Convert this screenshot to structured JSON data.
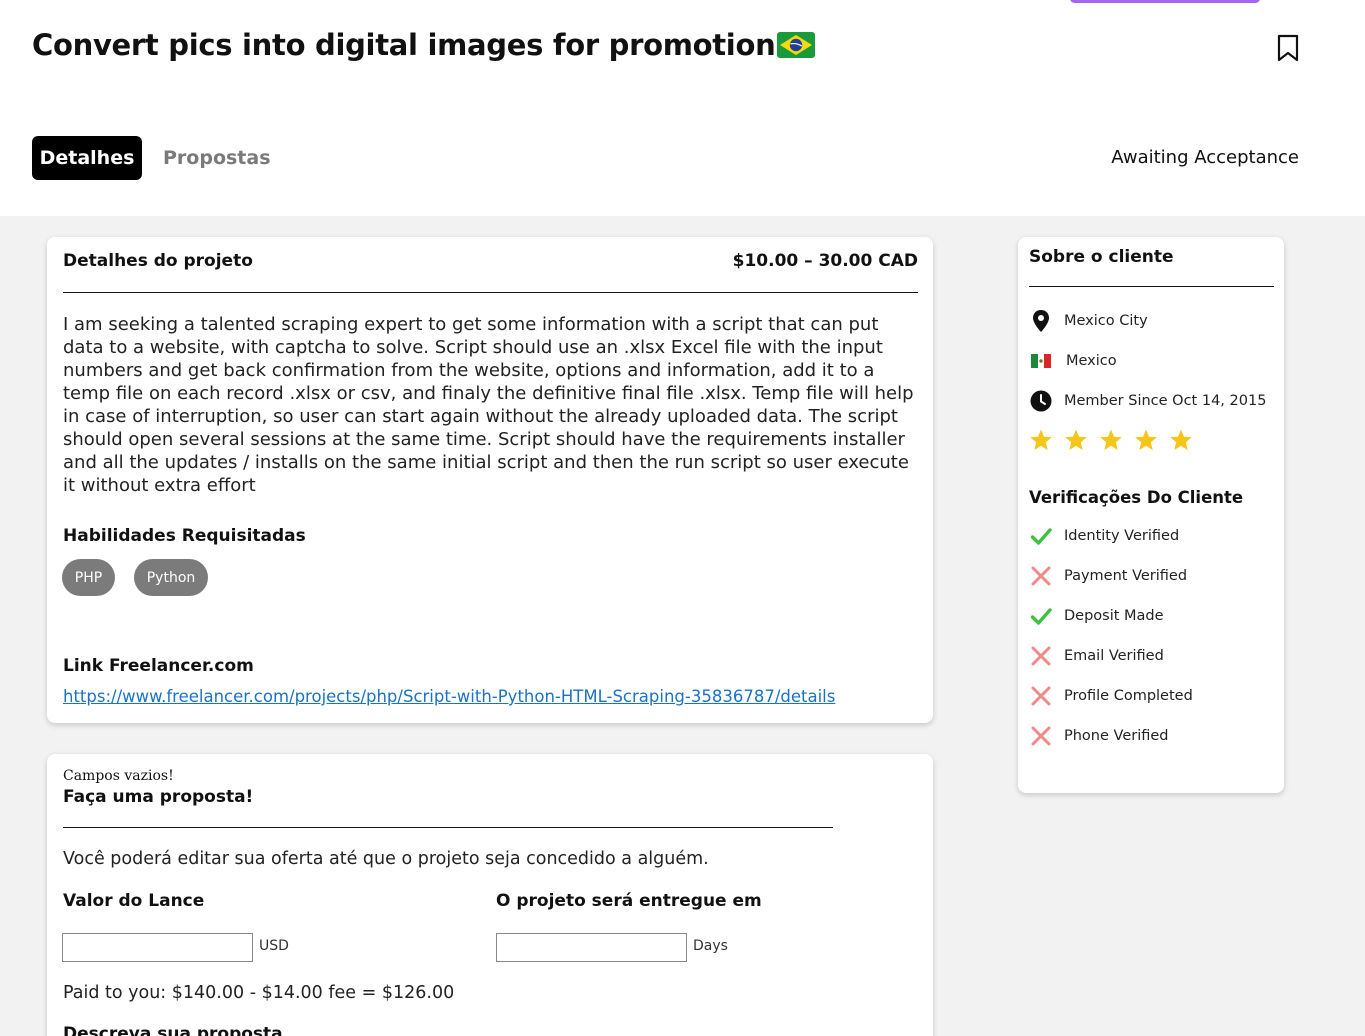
{
  "header": {
    "title": "Convert pics into digital images for promotion",
    "title_flag": "brazil-flag",
    "bookmark_icon": "bookmark-icon",
    "tabs": [
      {
        "label": "Detalhes",
        "active": true
      },
      {
        "label": "Propostas",
        "active": false
      }
    ],
    "status": "Awaiting Acceptance",
    "accent": "#a766f0"
  },
  "project": {
    "heading": "Detalhes do projeto",
    "budget": "$10.00 – 30.00 CAD",
    "description": "I am seeking a talented scraping expert to get some information with a script that can put data to a website, with captcha to solve. Script should use an .xlsx Excel file with the input numbers and get back confirmation from the website, options and information, add it to a temp file on each record .xlsx or csv, and finaly the definitive final file .xlsx. Temp file will help in case of interruption, so user can start again without the already uploaded data. The script should open several sessions at the same time. Script should have the requirements installer and all the updates / installs on the same initial script and then the run script so user execute it without extra effort",
    "skills_heading": "Habilidades Requisitadas",
    "skills": [
      "PHP",
      "Python"
    ],
    "link_heading": "Link Freelancer.com",
    "link": "https://www.freelancer.com/projects/php/Script-with-Python-HTML-Scraping-35836787/details"
  },
  "proposal": {
    "empty_notice": "Campos vazios!",
    "heading": "Faça uma proposta!",
    "info": "Você poderá editar sua oferta até que o projeto seja concedido a alguém.",
    "bid_label": "Valor do Lance",
    "bid_value": "",
    "bid_unit": "USD",
    "delivery_label": "O projeto será entregue em",
    "delivery_value": "",
    "delivery_unit": "Days",
    "paid_text": "Paid to you: $140.00 - $14.00 fee = $126.00",
    "describe_label": "Descreva sua proposta"
  },
  "client": {
    "heading": "Sobre o cliente",
    "city": "Mexico City",
    "country": "Mexico",
    "member_since": "Member Since Oct 14, 2015",
    "rating_stars": 5,
    "verifications_heading": "Verificações Do Cliente",
    "verifications": [
      {
        "label": "Identity Verified",
        "verified": true
      },
      {
        "label": "Payment Verified",
        "verified": false
      },
      {
        "label": "Deposit Made",
        "verified": true
      },
      {
        "label": "Email Verified",
        "verified": false
      },
      {
        "label": "Profile Completed",
        "verified": false
      },
      {
        "label": "Phone Verified",
        "verified": false
      }
    ],
    "check_color": "#3cc23c",
    "cross_color": "#ee8a8a",
    "star_color": "#f5c518"
  }
}
